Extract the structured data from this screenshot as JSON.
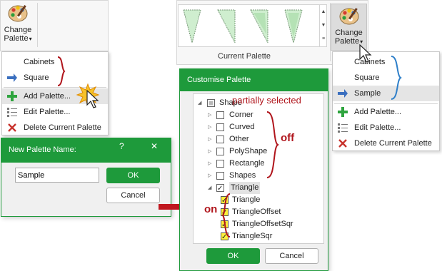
{
  "ribbon_left": {
    "change_palette_label_1": "Change",
    "change_palette_label_2": "Palette",
    "palette_icon": "palette-icon"
  },
  "ribbon_right": {
    "change_palette_label_1": "Change",
    "change_palette_label_2": "Palette",
    "gallery_caption": "Current Palette",
    "palette_icon": "palette-icon"
  },
  "menu_left": {
    "items": [
      "Cabinets",
      "Square"
    ],
    "add_palette": "Add Palette...",
    "edit_palette": "Edit Palette...",
    "delete_palette": "Delete Current Palette"
  },
  "menu_right": {
    "items": [
      "Cabinets",
      "Square",
      "Sample"
    ],
    "add_palette": "Add Palette...",
    "edit_palette": "Edit Palette...",
    "delete_palette": "Delete Current Palette"
  },
  "new_palette_dialog": {
    "title": "New Palette Name:",
    "help": "?",
    "close": "✕",
    "input_value": "Sample",
    "ok": "OK",
    "cancel": "Cancel"
  },
  "customise_dialog": {
    "title": "Customise Palette",
    "root": "Shape",
    "children": [
      "Corner",
      "Curved",
      "Other",
      "PolyShape",
      "Rectangle",
      "Shapes"
    ],
    "triangle": "Triangle",
    "triangle_children": [
      "Triangle",
      "TriangleOffset",
      "TriangleOffsetSqr",
      "TriangleSqr"
    ],
    "ok": "OK",
    "cancel": "Cancel"
  },
  "annotations": {
    "partially_selected": "partially selected",
    "off": "off",
    "on": "on"
  },
  "colors": {
    "accent_green": "#1e9a3b",
    "annotation_red": "#b0151c",
    "annotation_blue": "#2e7fc9",
    "highlight_yellow": "#ffef3a"
  }
}
